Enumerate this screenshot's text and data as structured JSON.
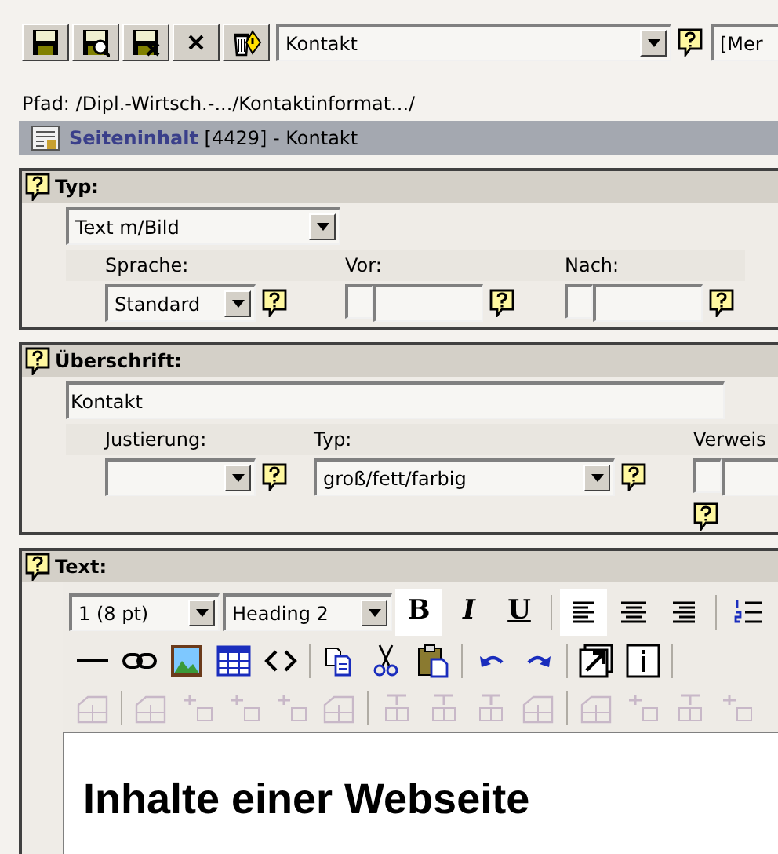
{
  "toolbar": {
    "buttons": [
      {
        "kind": "save"
      },
      {
        "kind": "save_view"
      },
      {
        "kind": "save_close"
      },
      {
        "kind": "close"
      },
      {
        "kind": "delete"
      }
    ],
    "page_select": "Kontakt",
    "second_select": "[Mer"
  },
  "path": "Pfad: /Dipl.-Wirtsch.-.../Kontaktinformat.../",
  "record": {
    "type": "Seiteninhalt",
    "info": "[4429] - Kontakt"
  },
  "typ_section": {
    "title": "Typ:",
    "type_value": "Text m/Bild",
    "fields": [
      {
        "label": "Sprache:",
        "kind": "select",
        "value": "Standard"
      },
      {
        "label": "Vor:",
        "kind": "checkbox_input",
        "checked": false
      },
      {
        "label": "Nach:",
        "kind": "checkbox_input",
        "checked": false
      }
    ]
  },
  "heading_section": {
    "title": "Überschrift:",
    "value": "Kontakt",
    "fields": [
      {
        "label": "Justierung:",
        "kind": "select"
      },
      {
        "label": "Typ:",
        "kind": "select",
        "value": "groß/fett/farbig"
      },
      {
        "label": "Verweis",
        "kind": "checkbox_input",
        "checked": false
      }
    ]
  },
  "text_section": {
    "title": "Text:",
    "size_select": "1 (8 pt)",
    "format_select": "Heading 2",
    "toolbar_rows": [
      [
        {
          "kind": "bold",
          "label": "B",
          "active": true
        },
        {
          "kind": "italic",
          "label": "I",
          "active": false
        },
        {
          "kind": "underline",
          "label": "U",
          "active": false
        },
        {
          "kind": "separator"
        },
        {
          "kind": "align_left",
          "active": true
        },
        {
          "kind": "align_center",
          "active": false
        },
        {
          "kind": "align_right",
          "active": false
        },
        {
          "kind": "separator"
        },
        {
          "kind": "ordered_list",
          "active": false
        }
      ],
      [
        {
          "kind": "rule"
        },
        {
          "kind": "link"
        },
        {
          "kind": "image"
        },
        {
          "kind": "table"
        },
        {
          "kind": "code"
        },
        {
          "kind": "separator"
        },
        {
          "kind": "copy"
        },
        {
          "kind": "cut"
        },
        {
          "kind": "paste"
        },
        {
          "kind": "separator"
        },
        {
          "kind": "undo"
        },
        {
          "kind": "redo"
        },
        {
          "kind": "separator"
        },
        {
          "kind": "popout"
        },
        {
          "kind": "info"
        },
        {
          "kind": "separator"
        }
      ],
      [
        {
          "kind": "table_props",
          "disabled": true
        },
        {
          "kind": "separator"
        },
        {
          "kind": "table_props",
          "disabled": true
        },
        {
          "kind": "row_insert",
          "disabled": true
        },
        {
          "kind": "row_insert",
          "disabled": true
        },
        {
          "kind": "row_insert",
          "disabled": true
        },
        {
          "kind": "table_props",
          "disabled": true
        },
        {
          "kind": "separator"
        },
        {
          "kind": "col_insert",
          "disabled": true
        },
        {
          "kind": "col_insert",
          "disabled": true
        },
        {
          "kind": "col_insert",
          "disabled": true
        },
        {
          "kind": "table_props",
          "disabled": true
        },
        {
          "kind": "separator"
        },
        {
          "kind": "table_props",
          "disabled": true
        },
        {
          "kind": "row_insert",
          "disabled": true
        },
        {
          "kind": "col_insert",
          "disabled": true
        },
        {
          "kind": "row_insert",
          "disabled": true
        }
      ]
    ],
    "content_heading": "Inhalte einer Webseite"
  }
}
